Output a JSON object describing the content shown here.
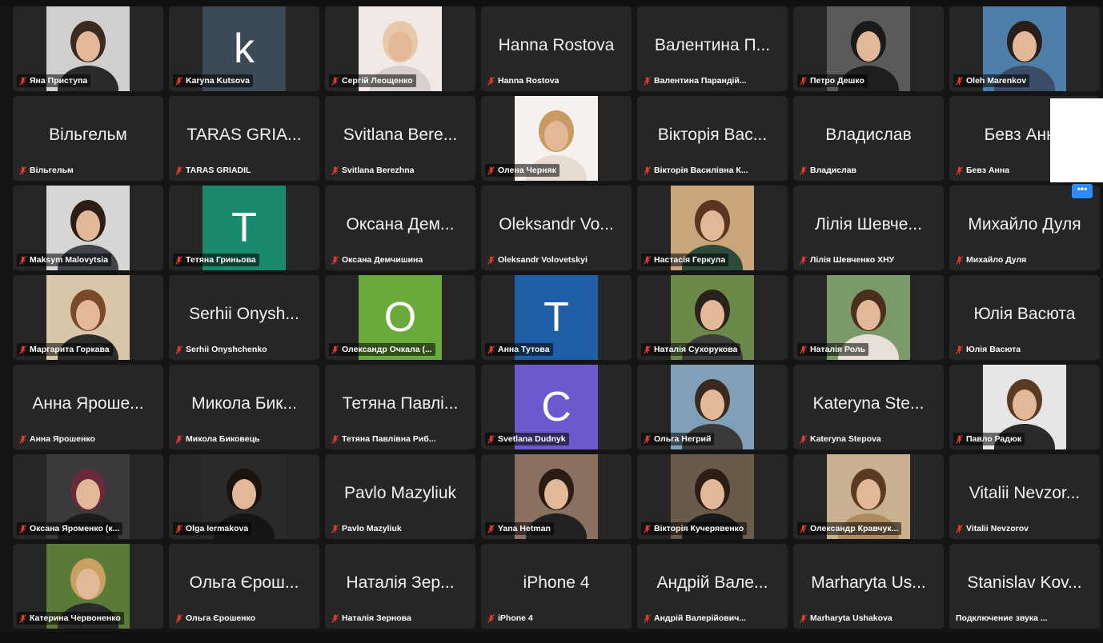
{
  "colors": {
    "background": "#151515",
    "tile": "#262626",
    "mic_muted": "#e03b2e",
    "more_button": "#2d8cff"
  },
  "more_button": {
    "icon": "ellipsis-icon",
    "label": "•••"
  },
  "participants": [
    {
      "name": "Яна Приступа",
      "avatar": {
        "kind": "photo",
        "bg": "#cfcfcf",
        "shirt": "#2a2a2a",
        "hair": "#3b2a1f"
      }
    },
    {
      "name": "Karyna Kutsova",
      "avatar": {
        "kind": "letter",
        "letter": "k",
        "color": "#3c4a57"
      }
    },
    {
      "name": "Сергій Леощенко",
      "avatar": {
        "kind": "photo",
        "bg": "#f2e9e6",
        "shirt": "#d8d0cc",
        "hair": "#e6c9a8"
      }
    },
    {
      "name": "Hanna Rostova",
      "display": "Hanna Rostova"
    },
    {
      "name": "Валентина Парандій...",
      "display": "Валентина П..."
    },
    {
      "name": "Петро Дешко",
      "avatar": {
        "kind": "photo",
        "bg": "#5a5a5a",
        "shirt": "#1e1e1e",
        "hair": "#1a1a1a"
      }
    },
    {
      "name": "Oleh Marenkov",
      "avatar": {
        "kind": "photo",
        "bg": "#4d7fa8",
        "shirt": "#3a4c66",
        "hair": "#2a1f18"
      }
    },
    {
      "name": "Вільгельм",
      "display": "Вільгельм"
    },
    {
      "name": "TARAS GRIADIL",
      "display": "TARAS GRIA..."
    },
    {
      "name": "Svitlana Berezhna",
      "display": "Svitlana Bere..."
    },
    {
      "name": "Олена Черняк",
      "avatar": {
        "kind": "photo",
        "bg": "#f4f1ee",
        "shirt": "#e8dcd0",
        "hair": "#c99a62"
      }
    },
    {
      "name": "Вікторія Василівна К...",
      "display": "Вікторія Вас..."
    },
    {
      "name": "Владислав",
      "display": "Владислав"
    },
    {
      "name": "Бевз Анна",
      "display": "Бевз Анна"
    },
    {
      "name": "Maksym Malovytsia",
      "avatar": {
        "kind": "photo",
        "bg": "#d6d6d6",
        "shirt": "#40444a",
        "hair": "#2b1e16"
      }
    },
    {
      "name": "Тетяна Гриньова",
      "avatar": {
        "kind": "letter",
        "letter": "T",
        "color": "#1a8a6e"
      }
    },
    {
      "name": "Оксана Демчишина",
      "display": "Оксана Дем..."
    },
    {
      "name": "Oleksandr Volovetskyi",
      "display": "Oleksandr Vo..."
    },
    {
      "name": "Настасія Геркула",
      "avatar": {
        "kind": "photo",
        "bg": "#c9a57c",
        "shirt": "#2e4a3a",
        "hair": "#5a3520"
      }
    },
    {
      "name": "Лілія Шевченко ХНУ",
      "display": "Лілія Шевче..."
    },
    {
      "name": "Михайло Дуля",
      "display": "Михайло Дуля"
    },
    {
      "name": "Маргарита Горкава",
      "avatar": {
        "kind": "photo",
        "bg": "#d8c6a8",
        "shirt": "#2c2c2c",
        "hair": "#7a4a28"
      }
    },
    {
      "name": "Serhii Onyshchenko",
      "display": "Serhii Onysh..."
    },
    {
      "name": "Олександр Очкала (...",
      "avatar": {
        "kind": "letter",
        "letter": "O",
        "color": "#6aaa3a"
      }
    },
    {
      "name": "Анна Тутова",
      "avatar": {
        "kind": "letter",
        "letter": "T",
        "color": "#1f5fa8"
      }
    },
    {
      "name": "Наталія Сухорукова",
      "avatar": {
        "kind": "photo",
        "bg": "#6b8a4a",
        "shirt": "#3c3c3c",
        "hair": "#2a221c"
      }
    },
    {
      "name": "Наталія Роль",
      "avatar": {
        "kind": "photo",
        "bg": "#7a9a6a",
        "shirt": "#e8e0d8",
        "hair": "#4a2e1e"
      }
    },
    {
      "name": "Юлія Васюта",
      "display": "Юлія Васюта"
    },
    {
      "name": "Анна Ярошенко",
      "display": "Анна Ярoше..."
    },
    {
      "name": "Микола Биковець",
      "display": "Микола Бик..."
    },
    {
      "name": "Тетяна Павлівна Риб...",
      "display": "Тетяна Павлі..."
    },
    {
      "name": "Svetlana Dudnyk",
      "avatar": {
        "kind": "letter",
        "letter": "C",
        "color": "#6a5acd"
      }
    },
    {
      "name": "Ольга Негрий",
      "avatar": {
        "kind": "photo",
        "bg": "#7fa0b8",
        "shirt": "#3a3a3a",
        "hair": "#3a2a1e"
      }
    },
    {
      "name": "Kateryna Stepova",
      "display": "Kateryna Ste..."
    },
    {
      "name": "Павло Радюк",
      "avatar": {
        "kind": "photo",
        "bg": "#e6e6e6",
        "shirt": "#2a2a2a",
        "hair": "#5a3a22"
      }
    },
    {
      "name": "Оксана Яроменко (к...",
      "avatar": {
        "kind": "photo",
        "bg": "#3a3a3a",
        "shirt": "#1c1c1c",
        "hair": "#6a2a3a"
      }
    },
    {
      "name": "Olga Iermakova",
      "avatar": {
        "kind": "photo",
        "bg": "#2a2a2a",
        "shirt": "#151515",
        "hair": "#1a1410"
      }
    },
    {
      "name": "Pavlo Mazyliuk",
      "display": "Pavlo Mazyliuk"
    },
    {
      "name": "Yana Hetman",
      "avatar": {
        "kind": "photo",
        "bg": "#8a7060",
        "shirt": "#222222",
        "hair": "#2a1c14"
      }
    },
    {
      "name": "Вікторія Кучерявенко",
      "avatar": {
        "kind": "photo",
        "bg": "#6a5a4a",
        "shirt": "#1a1a1a",
        "hair": "#2a1e16"
      }
    },
    {
      "name": "Олександр Кравчук...",
      "avatar": {
        "kind": "photo",
        "bg": "#c8b090",
        "shirt": "#b08a60",
        "hair": "#5a3a22"
      }
    },
    {
      "name": "Vitalii Nevzorov",
      "display": "Vitalii Nevzor..."
    },
    {
      "name": "Катерина Червоненко",
      "avatar": {
        "kind": "photo",
        "bg": "#5a7a3a",
        "shirt": "#2a2a2a",
        "hair": "#c8a060"
      }
    },
    {
      "name": "Ольга Єрошенко",
      "display": "Ольга Єрош..."
    },
    {
      "name": "Наталія Зернова",
      "display": "Наталія Зер..."
    },
    {
      "name": "iPhone 4",
      "display": "iPhone 4"
    },
    {
      "name": "Андрій Валерійович...",
      "display": "Андрій Вале..."
    },
    {
      "name": "Marharyta Ushakova",
      "display": "Marharyta Us..."
    },
    {
      "name": "Подключение звука ...",
      "display": "Stanislav Kov...",
      "no_mic": true
    }
  ]
}
